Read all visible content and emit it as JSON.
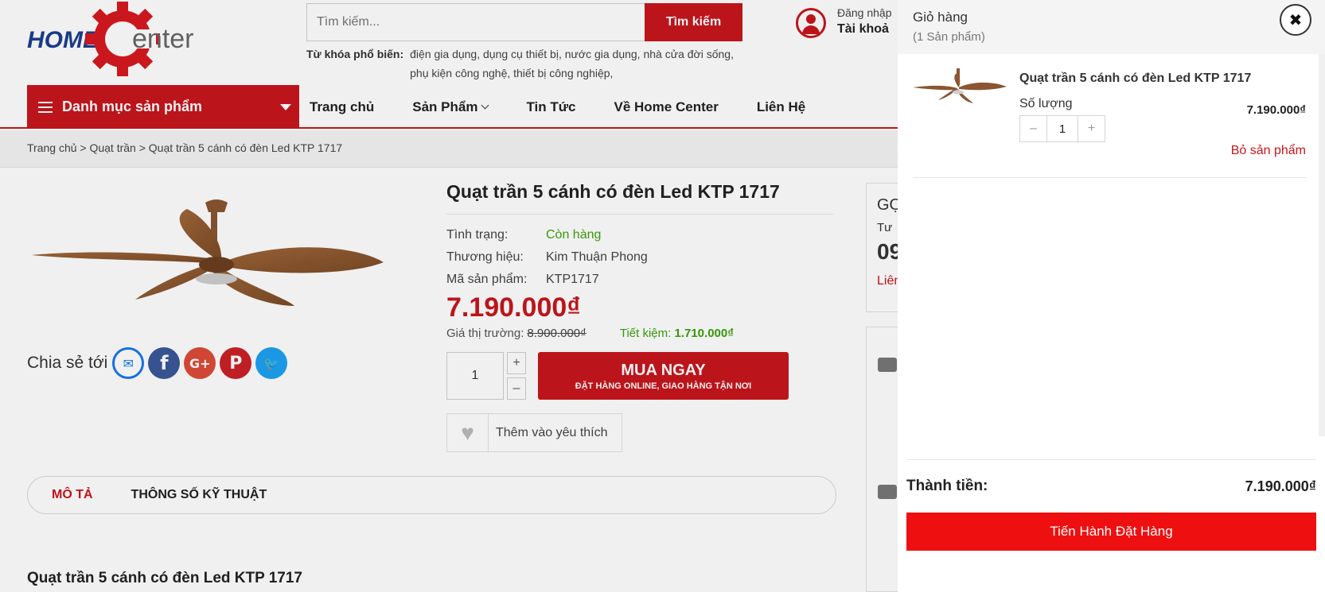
{
  "header": {
    "logo_text": "HOME Center",
    "search_placeholder": "Tìm kiếm...",
    "search_button": "Tìm kiếm",
    "keywords_label": "Từ khóa phổ biến:",
    "keywords": "điện gia dụng, dụng cụ thiết bị, nước gia dụng, nhà cửa đời sống, phụ kiện công nghệ, thiết bị công nghiệp,",
    "account_login": "Đăng nhập",
    "account_label": "Tài khoả"
  },
  "nav": {
    "category_button": "Danh mục sản phẩm",
    "items": [
      "Trang chủ",
      "Sản Phẩm",
      "Tin Tức",
      "Về Home Center",
      "Liên Hệ"
    ]
  },
  "breadcrumb": "Trang chủ > Quạt trần > Quạt trần 5 cánh có đèn Led KTP 1717",
  "product": {
    "share_label": "Chia sẻ tới",
    "title": "Quạt trần 5 cánh có đèn Led KTP 1717",
    "status_label": "Tình trạng:",
    "status_value": "Còn hàng",
    "brand_label": "Thương hiệu:",
    "brand_value": "Kim Thuận Phong",
    "sku_label": "Mã sản phẩm:",
    "sku_value": "KTP1717",
    "price": "7.190.000₫",
    "market_label": "Giá thị trường:",
    "market_price": "8.900.000₫",
    "save_label": "Tiết kiệm:",
    "save_value": "1.710.000₫",
    "quantity": "1",
    "qty_plus": "+",
    "qty_minus": "–",
    "buy_main": "MUA NGAY",
    "buy_sub": "ĐẶT HÀNG ONLINE, GIAO HÀNG TẬN NƠI",
    "wishlist": "Thêm vào yêu thích"
  },
  "tabs": [
    "MÔ TẢ",
    "THÔNG SỐ KỸ THUẬT"
  ],
  "description_title": "Quạt trần 5 cánh có đèn Led KTP 1717",
  "side": {
    "line1": "GỌ",
    "line2": "Tư",
    "line3": "09",
    "line4": "Liên"
  },
  "cart": {
    "title": "Giỏ hàng",
    "count": "(1 Sản phẩm)",
    "close": "✖",
    "item_name": "Quạt trần 5 cánh có đèn Led KTP 1717",
    "qty_label": "Số lượng",
    "qty_value": "1",
    "qty_minus": "–",
    "qty_plus": "+",
    "item_price": "7.190.000₫",
    "remove": "Bỏ sản phẩm",
    "total_label": "Thành tiền:",
    "total_value": "7.190.000₫",
    "checkout": "Tiến Hành Đặt Hàng"
  },
  "colors": {
    "brand_red": "#c8161d",
    "checkout_red": "#ee1010",
    "in_stock_green": "#3aa30c"
  }
}
